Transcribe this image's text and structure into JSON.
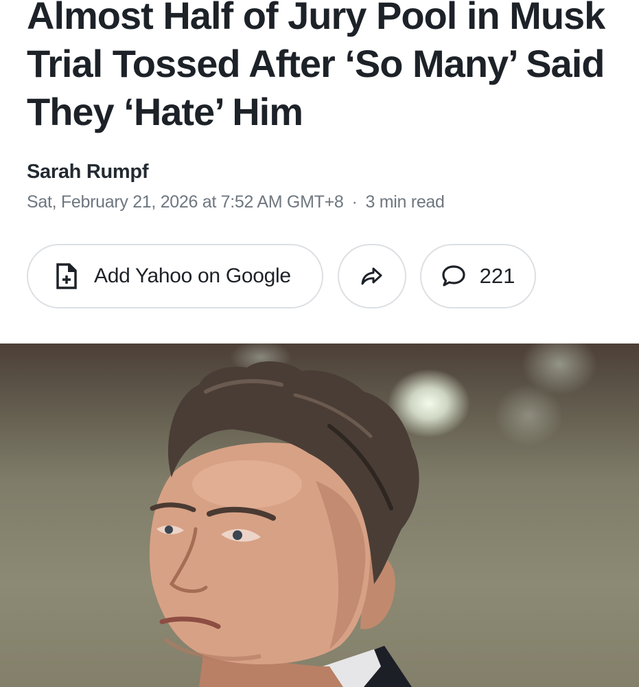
{
  "article": {
    "headline": "Almost Half of Jury Pool in Musk Trial Tossed After ‘So Many’ Said They ‘Hate’ Him",
    "author": "Sarah Rumpf",
    "date": "Sat, February 21, 2026 at 7:52 AM GMT+8",
    "separator": "·",
    "read_time": "3 min read"
  },
  "actions": {
    "google_label": "Add Yahoo on Google",
    "comment_count": "221"
  },
  "icons": {
    "google": "add-document-icon",
    "share": "share-arrow-icon",
    "comment": "speech-bubble-icon"
  },
  "hero": {
    "subject": "portrait-photo"
  }
}
